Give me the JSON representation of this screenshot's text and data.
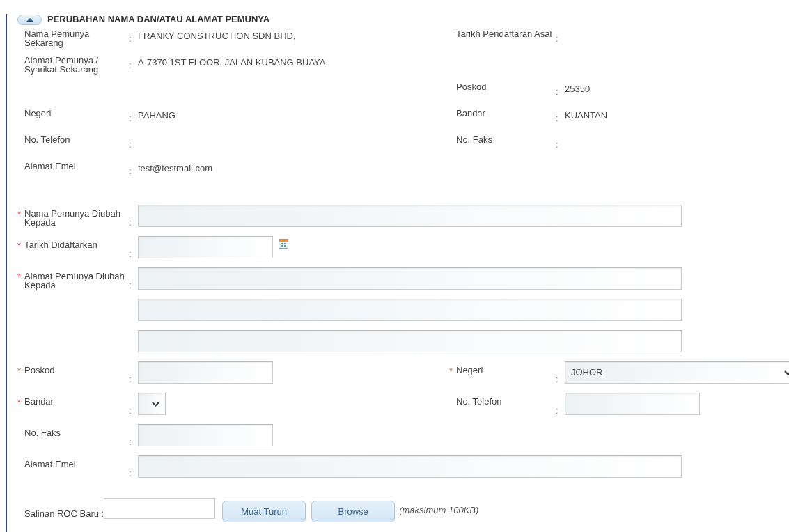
{
  "section": {
    "title": "PERUBAHAN NAMA DAN/ATAU ALAMAT PEMUNYA",
    "expanded": true
  },
  "current": [
    {
      "left": {
        "label": "Nama Pemunya Sekarang",
        "sep": ":",
        "value": "FRANKY CONSTRUCTION SDN BHD,"
      },
      "right": {
        "label": "Tarikh Pendaftaran Asal",
        "sep": ":"
      }
    },
    {
      "left": {
        "label": "Alamat Pemunya / Syarikat Sekarang",
        "sep": ":",
        "value": "A-7370 1ST FLOOR, JALAN KUBANG BUAYA,"
      }
    },
    {
      "right": {
        "label": "Poskod",
        "sep": ":",
        "value": "25350"
      }
    },
    {
      "left": {
        "label": "Negeri",
        "sep": ":",
        "value": "PAHANG"
      },
      "right": {
        "label": "Bandar",
        "sep": ":",
        "value": "KUANTAN"
      }
    },
    {
      "left": {
        "label": "No. Telefon",
        "sep": ":"
      },
      "right": {
        "label": "No. Faks",
        "sep": ":"
      }
    },
    {
      "left": {
        "label": "Alamat Emel",
        "sep": ":",
        "value": "test@testmail.com"
      }
    }
  ],
  "form": [
    {
      "left": {
        "mark": "*",
        "label": "Nama Pemunya Diubah Kepada",
        "sep": ":",
        "kind": "long-input"
      }
    },
    {
      "left": {
        "mark": "*",
        "label": "Tarikh Didaftarkan",
        "sep": ":",
        "kind": "date-input"
      }
    },
    {
      "left": {
        "mark": "*",
        "label": "Alamat Pemunya Diubah Kepada",
        "sep": ":",
        "kind": "long-input"
      }
    },
    {
      "left": {
        "kind": "long-input"
      }
    },
    {
      "left": {
        "kind": "long-input"
      }
    },
    {
      "left": {
        "mark": "*",
        "label": "Poskod",
        "sep": ":",
        "kind": "short-input"
      },
      "right": {
        "mark": "*",
        "label": "Negeri",
        "sep": ":",
        "kind": "wide-select",
        "value": "JOHOR"
      }
    },
    {
      "left": {
        "mark": "*",
        "label": "Bandar",
        "sep": ":",
        "kind": "small-select"
      },
      "right": {
        "label": "No. Telefon",
        "sep": ":",
        "kind": "short-input"
      }
    },
    {
      "left": {
        "label": "No. Faks",
        "sep": ":",
        "kind": "short-input"
      }
    },
    {
      "left": {
        "label": "Alamat Emel",
        "sep": ":",
        "kind": "long-input"
      }
    }
  ],
  "upload": {
    "label": "Salinan ROC Baru :",
    "buttons": [
      "Muat Turun",
      "Browse"
    ],
    "note": "(maksimum 100KB)"
  }
}
